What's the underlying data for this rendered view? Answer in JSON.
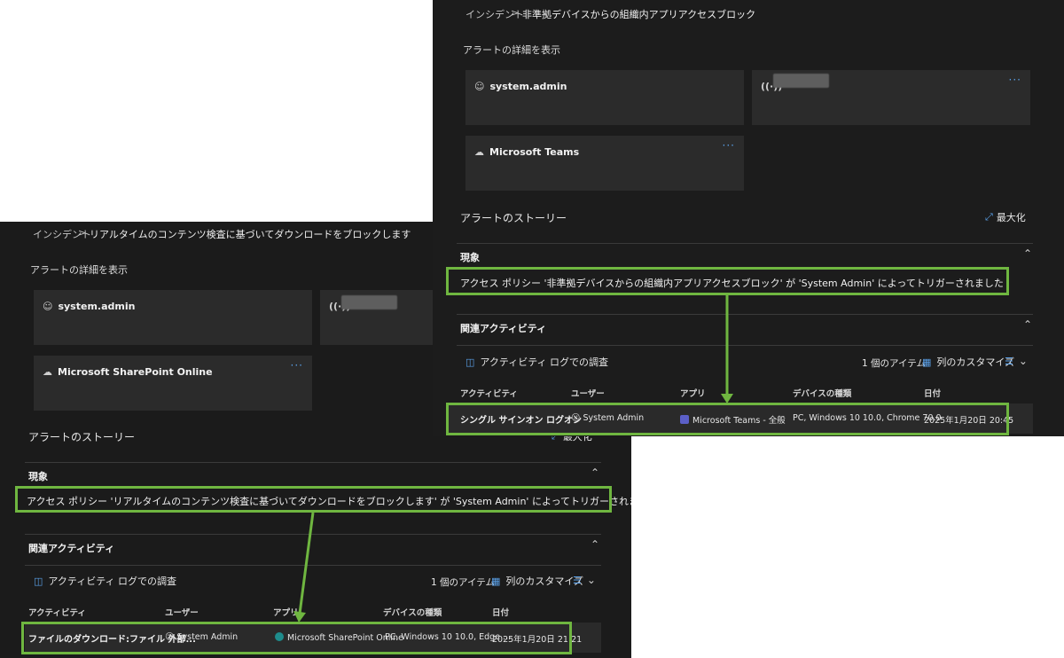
{
  "back": {
    "breadcrumb": {
      "root": "インシデント",
      "sep": ">",
      "current": "リアルタイムのコンテンツ検査に基づいてダウンロードをブロックします"
    },
    "section_label": "アラートの詳細を表示",
    "card_user": {
      "icon": "person-icon",
      "label": "system.admin"
    },
    "card_device": {
      "icon": "broadcast-icon"
    },
    "card_app": {
      "icon": "cloud-icon",
      "label": "Microsoft SharePoint Online",
      "more": "···"
    },
    "story_title": "アラートのストーリー",
    "maximize_label": "最大化",
    "phenomenon_head": "現象",
    "phenomenon_text": "アクセス ポリシー 'リアルタイムのコンテンツ検査に基づいてダウンロードをブロックします' が 'System Admin' によってトリガーされました",
    "related_head": "関連アクティビティ",
    "tool_investigate": "アクティビティ ログでの調査",
    "item_count": "1 個のアイテム",
    "customize_cols": "列のカスタマイズ",
    "columns": {
      "activity": "アクティビティ",
      "user": "ユーザー",
      "app": "アプリ",
      "device": "デバイスの種類",
      "date": "日付"
    },
    "row": {
      "activity": "ファイルのダウンロード:ファイル 外部...",
      "user": "System Admin",
      "app": "Microsoft SharePoint Online",
      "device": "PC, Windows 10 10.0, Edge ...",
      "date": "2025年1月20日 21:21"
    }
  },
  "front": {
    "breadcrumb": {
      "root": "インシデント",
      "sep": ">",
      "current": "非準拠デバイスからの組織内アプリアクセスブロック"
    },
    "section_label": "アラートの詳細を表示",
    "card_user": {
      "icon": "person-icon",
      "label": "system.admin"
    },
    "card_device": {
      "icon": "broadcast-icon",
      "more": "···"
    },
    "card_app": {
      "icon": "cloud-icon",
      "label": "Microsoft Teams",
      "more": "···"
    },
    "story_title": "アラートのストーリー",
    "maximize_label": "最大化",
    "phenomenon_head": "現象",
    "phenomenon_text": "アクセス ポリシー '非準拠デバイスからの組織内アプリアクセスブロック' が 'System Admin' によってトリガーされました",
    "related_head": "関連アクティビティ",
    "tool_investigate": "アクティビティ ログでの調査",
    "item_count": "1 個のアイテム",
    "customize_cols": "列のカスタマイズ",
    "columns": {
      "activity": "アクティビティ",
      "user": "ユーザー",
      "app": "アプリ",
      "device": "デバイスの種類",
      "date": "日付"
    },
    "row": {
      "activity": "シングル サインオン ログオン",
      "user": "System Admin",
      "app": "Microsoft Teams - 全般",
      "device": "PC, Windows 10 10.0, Chrome 70.0",
      "date": "2025年1月20日 20:45"
    }
  },
  "colors": {
    "highlight": "#6fb640",
    "accent": "#5aa0e8",
    "panel": "#1b1b1b",
    "card": "#2b2b2b"
  }
}
